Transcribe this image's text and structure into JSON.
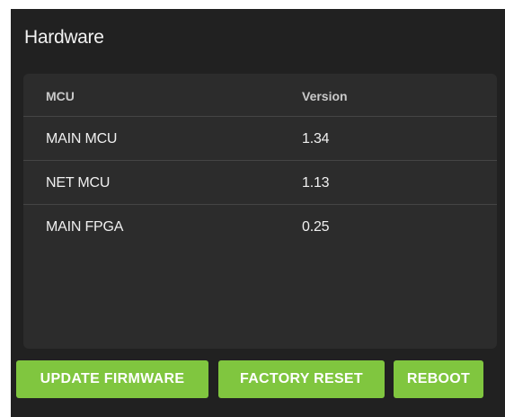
{
  "panel": {
    "title": "Hardware"
  },
  "table": {
    "headers": [
      "MCU",
      "Version"
    ],
    "rows": [
      {
        "mcu": "MAIN MCU",
        "version": "1.34"
      },
      {
        "mcu": "NET MCU",
        "version": "1.13"
      },
      {
        "mcu": "MAIN FPGA",
        "version": "0.25"
      }
    ]
  },
  "actions": {
    "update_firmware": "UPDATE FIRMWARE",
    "factory_reset": "FACTORY RESET",
    "reboot": "REBOOT"
  },
  "colors": {
    "panel_bg": "#212121",
    "card_bg": "#2c2c2c",
    "accent_green": "#80c63f"
  }
}
